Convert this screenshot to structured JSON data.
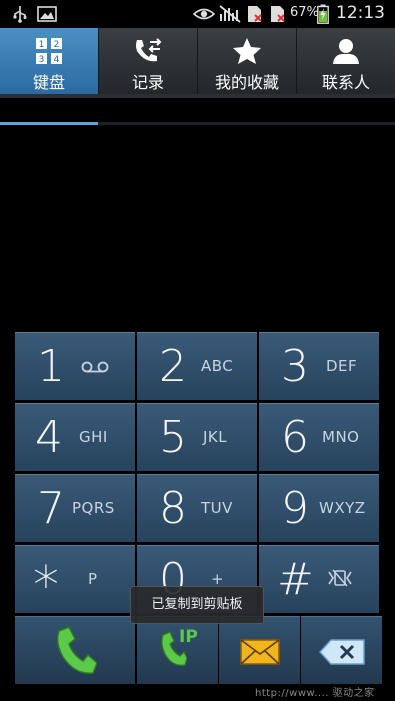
{
  "status_bar": {
    "battery_percent": "67%",
    "time": "12:13",
    "icons": [
      "usb-icon",
      "image-icon",
      "eye-icon",
      "signal-muted-icon",
      "sim-error-icon",
      "sim-error-icon",
      "battery-charging-icon"
    ]
  },
  "tabs": [
    {
      "label": "键盘",
      "icon": "keypad-icon",
      "active": true
    },
    {
      "label": "记录",
      "icon": "call-log-icon",
      "active": false
    },
    {
      "label": "我的收藏",
      "icon": "star-icon",
      "active": false
    },
    {
      "label": "联系人",
      "icon": "contact-icon",
      "active": false
    }
  ],
  "keypad": {
    "keys": [
      {
        "digit": "1",
        "letters": ""
      },
      {
        "digit": "2",
        "letters": "ABC"
      },
      {
        "digit": "3",
        "letters": "DEF"
      },
      {
        "digit": "4",
        "letters": "GHI"
      },
      {
        "digit": "5",
        "letters": "JKL"
      },
      {
        "digit": "6",
        "letters": "MNO"
      },
      {
        "digit": "7",
        "letters": "PQRS"
      },
      {
        "digit": "8",
        "letters": "TUV"
      },
      {
        "digit": "9",
        "letters": "WXYZ"
      },
      {
        "digit": "*",
        "letters": "P"
      },
      {
        "digit": "0",
        "letters": "+"
      },
      {
        "digit": "#",
        "letters": ""
      }
    ]
  },
  "actions": {
    "call_icon": "phone-call-icon",
    "ip_call_label": "IP",
    "message_icon": "envelope-icon",
    "delete_icon": "backspace-icon"
  },
  "toast": "已复制到剪贴板",
  "watermark": "http://www.... 驱动之家",
  "colors": {
    "active_tab": "#3f84bd",
    "key_bg": "#30506c",
    "call_green": "#5cc94a",
    "message_yellow": "#f2b51e"
  }
}
